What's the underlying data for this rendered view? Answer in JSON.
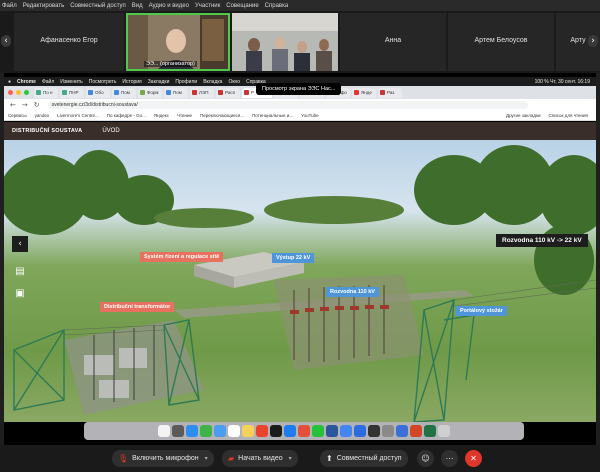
{
  "zoom_menu": [
    "Файл",
    "Редактировать",
    "Совместный доступ",
    "Вид",
    "Аудио и видео",
    "Участник",
    "Совещание",
    "Справка"
  ],
  "participants": [
    {
      "name": ""
    },
    {
      "name": "Афанасенко Егор"
    },
    {
      "name": "ЭЭ... (организатор)"
    },
    {
      "name": ""
    },
    {
      "name": "Анна"
    },
    {
      "name": "Артем Белоусов"
    },
    {
      "name": "Арту"
    }
  ],
  "share_tooltip": "Просмотр экрана ЭЭС Нас...",
  "mac_menu": [
    "Chrome",
    "Файл",
    "Изменить",
    "Посмотреть",
    "История",
    "Закладки",
    "Профили",
    "Вкладка",
    "Окно",
    "Справка"
  ],
  "mac_status": "100 %  Чт, 30 сент. 16:19",
  "tabs": [
    "По н",
    "ПНР",
    "Обо",
    "Пом",
    "Форм",
    "Пом",
    "ЛЭП",
    "Расп",
    "Р",
    "Расп",
    "Янде",
    "Инфо",
    "Янде",
    "Раз"
  ],
  "url": "svetenergie.cz/3d/distribucni-soustava/",
  "bookmarks": [
    "Сервисы",
    "yandex",
    "Livermore's Centre...",
    "По кафедре - Go...",
    "Яндекс",
    "Чтение",
    "Переключающиеся...",
    "Потенциальные и...",
    "YouTube",
    "Другие закладки",
    "Список для чтения"
  ],
  "site": {
    "logo": "DISTRIBUČNÍ SOUSTAVA",
    "nav": "ÚVOD"
  },
  "scene_labels": {
    "systemove_rizeni": "Systém řízení a regulace sítě",
    "vystup": "Výstup 22 kV",
    "rozvodna110": "Rozvodna 110 kV",
    "distribucni": "Distribuční transformátor",
    "portalovy": "Portálový stožár",
    "top_right": "Rozvodna 110 kV -> 22 kV"
  },
  "controls": {
    "mic": "Включить микрофон",
    "video": "Начать видео",
    "share": "Совместный доступ"
  }
}
